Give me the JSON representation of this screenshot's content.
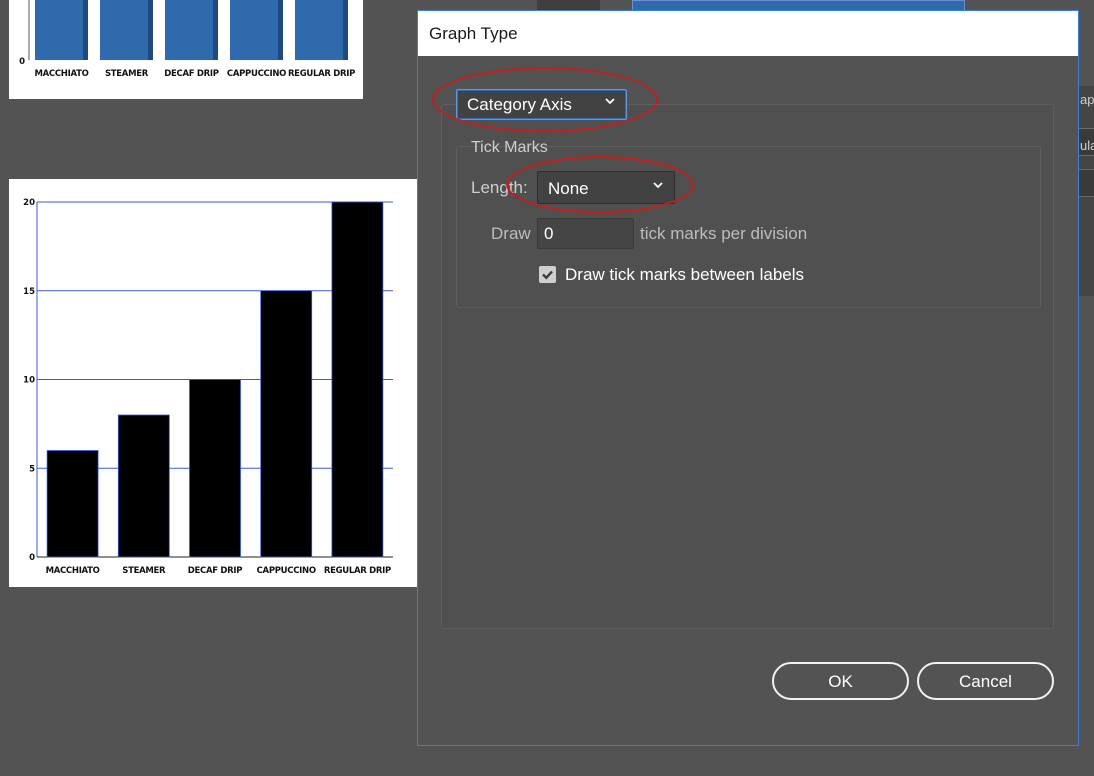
{
  "background": {
    "top_chart": {
      "categories": [
        "MACCHIATO",
        "STEAMER",
        "DECAF DRIP",
        "CAPPUCCINO",
        "REGULAR DRIP"
      ],
      "zero_label": "0",
      "bar_color": "#2f6aad"
    },
    "main_chart": {
      "y_ticks": [
        "0",
        "5",
        "10",
        "15",
        "20"
      ]
    }
  },
  "chart_data": {
    "type": "bar",
    "categories": [
      "MACCHIATO",
      "STEAMER",
      "DECAF DRIP",
      "CAPPUCCINO",
      "REGULAR DRIP"
    ],
    "values": [
      6,
      8,
      10,
      15,
      20
    ],
    "ylim": [
      0,
      20
    ],
    "yticks": [
      0,
      5,
      10,
      15,
      20
    ],
    "grid": true,
    "bar_color": "#000000",
    "gridline_color": "#3b5bd6"
  },
  "right_panel": {
    "texts": [
      "ap",
      "ula"
    ]
  },
  "dialog": {
    "title": "Graph Type",
    "axis_select": {
      "value": "Category Axis"
    },
    "tick_marks": {
      "title": "Tick Marks",
      "length_label": "Length:",
      "length_value": "None",
      "draw_label": "Draw",
      "draw_value": "0",
      "per_division": "tick marks per division",
      "between_labels": "Draw tick marks between labels",
      "between_checked": true
    },
    "ok_label": "OK",
    "cancel_label": "Cancel"
  },
  "colors": {
    "accent": "#3c7fd6",
    "annotation": "#cc1b1b"
  }
}
